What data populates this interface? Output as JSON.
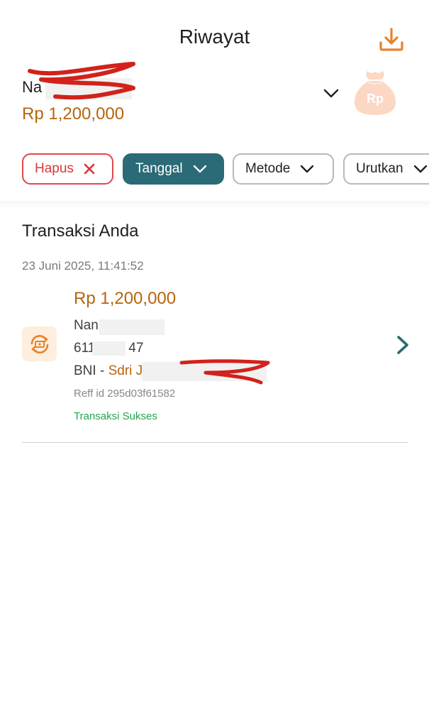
{
  "header": {
    "title": "Riwayat",
    "download_icon": "download-icon"
  },
  "account": {
    "name_visible": "Na",
    "balance": "Rp 1,200,000",
    "dropdown_icon": "chevron-down-icon",
    "badge_icon": "money-bag-icon",
    "badge_text": "Rp"
  },
  "filters": [
    {
      "label": "Hapus",
      "icon": "close-icon"
    },
    {
      "label": "Tanggal",
      "icon": "chevron-down-icon"
    },
    {
      "label": "Metode",
      "icon": "chevron-down-icon"
    },
    {
      "label": "Urutkan",
      "icon": "chevron-down-icon"
    }
  ],
  "section": {
    "title": "Transaksi Anda"
  },
  "transactions": [
    {
      "date": "23 Juni 2025, 11:41:52",
      "amount": "Rp 1,200,000",
      "name_visible": "Nan",
      "account_start": "611",
      "account_end": "47",
      "bank": "BNI",
      "separator": "-",
      "holder_visible": "Sdri J",
      "reff": "Reff id 295d03f61582",
      "status": "Transaksi Sukses",
      "icon": "transfer-icon",
      "arrow_icon": "chevron-right-icon"
    }
  ],
  "colors": {
    "accent": "#b5650d",
    "primary": "#2b6a77",
    "danger": "#d9373a",
    "success": "#23a74a",
    "download": "#e8822a"
  }
}
